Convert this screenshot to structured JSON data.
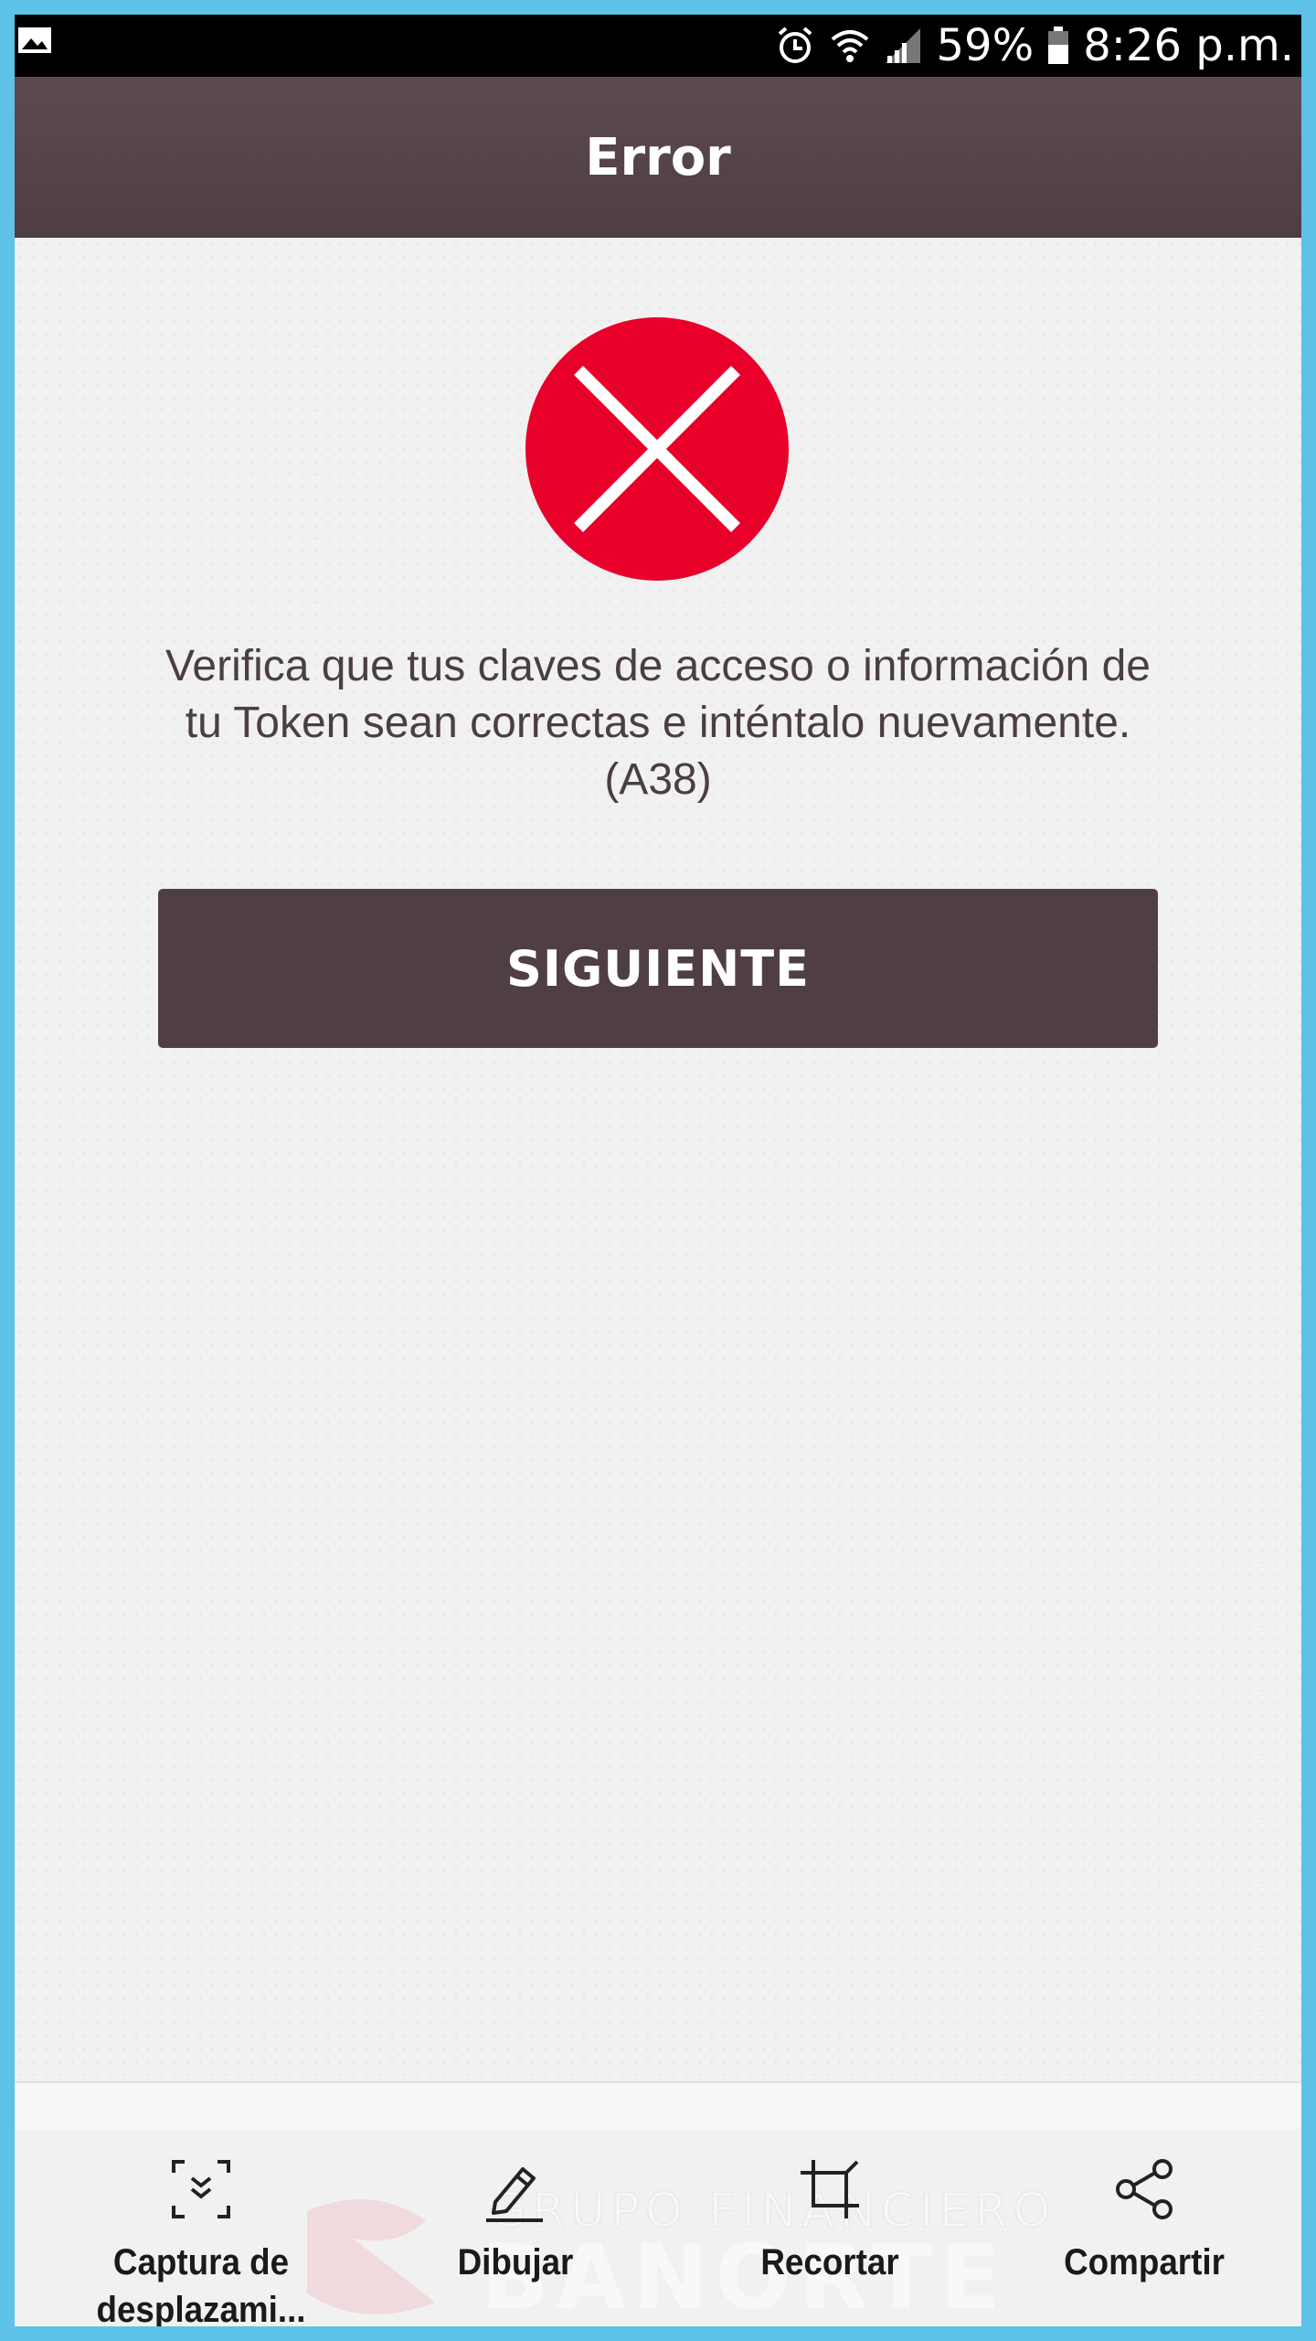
{
  "status_bar": {
    "battery_percent": "59%",
    "time": "8:26 p.m.",
    "icons": [
      "gallery-icon",
      "alarm-icon",
      "wifi-icon",
      "signal-icon",
      "battery-icon"
    ]
  },
  "header": {
    "title": "Error"
  },
  "error": {
    "icon": "error-x-icon",
    "icon_color": "#e8002b",
    "message_line1": "Verifica que tus claves de acceso o información de",
    "message_line2": "tu Token sean correctas e inténtalo nuevamente.",
    "code": "(A38)"
  },
  "actions": {
    "next_label": "SIGUIENTE"
  },
  "toolbar": {
    "items": [
      {
        "label_line1": "Captura de",
        "label_line2": "desplazami...",
        "icon": "scroll-capture-icon"
      },
      {
        "label": "Dibujar",
        "icon": "pen-icon"
      },
      {
        "label": "Recortar",
        "icon": "crop-icon"
      },
      {
        "label": "Compartir",
        "icon": "share-icon"
      }
    ]
  },
  "watermark": {
    "line1": "GRUPO FINANCIERO",
    "line2": "BANORTE"
  },
  "colors": {
    "header_bg": "#4e3d44",
    "button_bg": "#4f3f45",
    "frame_border": "#5ec1e8"
  }
}
